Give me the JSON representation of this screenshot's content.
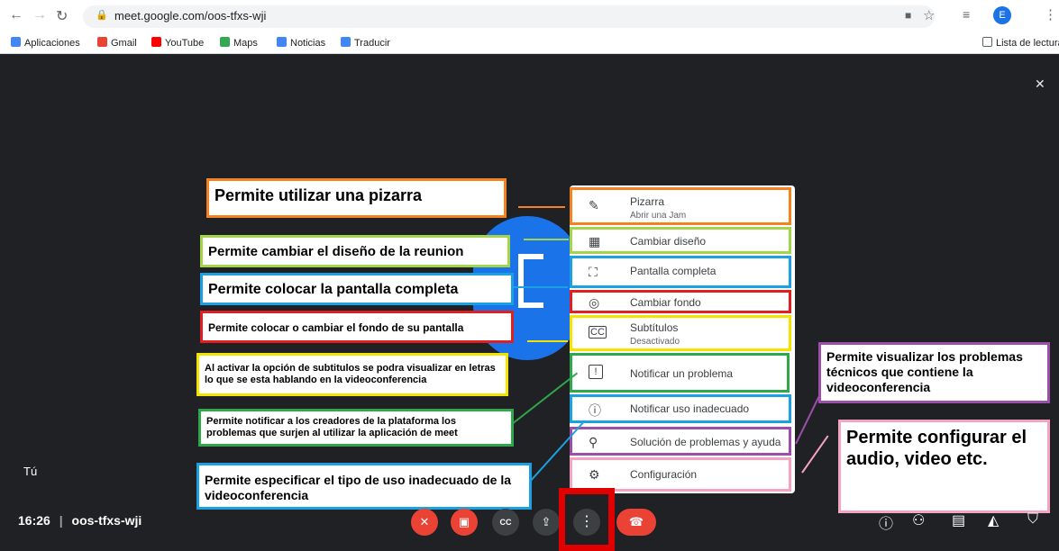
{
  "browser": {
    "url": "meet.google.com/oos-tfxs-wji",
    "avatar_letter": "E",
    "bookmarks": [
      {
        "label": "Aplicaciones",
        "icon": "apps-grid-icon",
        "color": "#4285f4"
      },
      {
        "label": "Gmail",
        "icon": "gmail-icon",
        "color": "#ea4335"
      },
      {
        "label": "YouTube",
        "icon": "youtube-icon",
        "color": "#ff0000"
      },
      {
        "label": "Maps",
        "icon": "maps-icon",
        "color": "#34a853"
      },
      {
        "label": "Noticias",
        "icon": "news-icon",
        "color": "#4285f4"
      },
      {
        "label": "Traducir",
        "icon": "translate-icon",
        "color": "#4285f4"
      }
    ],
    "reading_list": "Lista de lectura"
  },
  "meet": {
    "self_label": "Tú",
    "time": "16:26",
    "meeting_code": "oos-tfxs-wji",
    "accent": "#1a73e8",
    "end_call_color": "#ea4335"
  },
  "menu": {
    "items": [
      {
        "label": "Pizarra",
        "sub": "Abrir una Jam",
        "icon": "pen-icon",
        "glyph": "✎"
      },
      {
        "label": "Cambiar diseño",
        "sub": "",
        "icon": "layout-icon",
        "glyph": "▦"
      },
      {
        "label": "Pantalla completa",
        "sub": "",
        "icon": "fullscreen-icon",
        "glyph": "⛶"
      },
      {
        "label": "Cambiar fondo",
        "sub": "",
        "icon": "background-icon",
        "glyph": "◎"
      },
      {
        "label": "Subtítulos",
        "sub": "Desactivado",
        "icon": "captions-icon",
        "glyph": "㏄"
      },
      {
        "label": "Notificar un problema",
        "sub": "",
        "icon": "feedback-icon",
        "glyph": "!"
      },
      {
        "label": "Notificar uso inadecuado",
        "sub": "",
        "icon": "report-icon",
        "glyph": "ⓘ"
      },
      {
        "label": "Solución de problemas y ayuda",
        "sub": "",
        "icon": "troubleshoot-icon",
        "glyph": "⚲"
      },
      {
        "label": "Configuración",
        "sub": "",
        "icon": "settings-icon",
        "glyph": "⚙"
      }
    ]
  },
  "annotations": [
    {
      "text": "Permite utilizar una pizarra",
      "color": "#f58220"
    },
    {
      "text": "Permite cambiar el diseño de la reunion",
      "color": "#a4d44a"
    },
    {
      "text": "Permite colocar la pantalla completa",
      "color": "#1ba1e2"
    },
    {
      "text": "Permite colocar o cambiar el fondo de su pantalla",
      "color": "#e02020"
    },
    {
      "text": "Al activar la opción de subtitulos se podra visualizar en letras lo que se esta hablando en la videoconferencia",
      "color": "#f5e200"
    },
    {
      "text": "Permite notificar a los creadores de la plataforma los problemas que surjen al utilizar la aplicación de meet",
      "color": "#2ea84a"
    },
    {
      "text": "Permite especificar el tipo de uso inadecuado de la videoconferencia",
      "color": "#1ba1e2"
    },
    {
      "text": "Permite visualizar los problemas técnicos que contiene la videoconferencia",
      "color": "#9c4fa8"
    },
    {
      "text": "Permite configurar el audio, video etc.",
      "color": "#f4a3c0"
    }
  ]
}
